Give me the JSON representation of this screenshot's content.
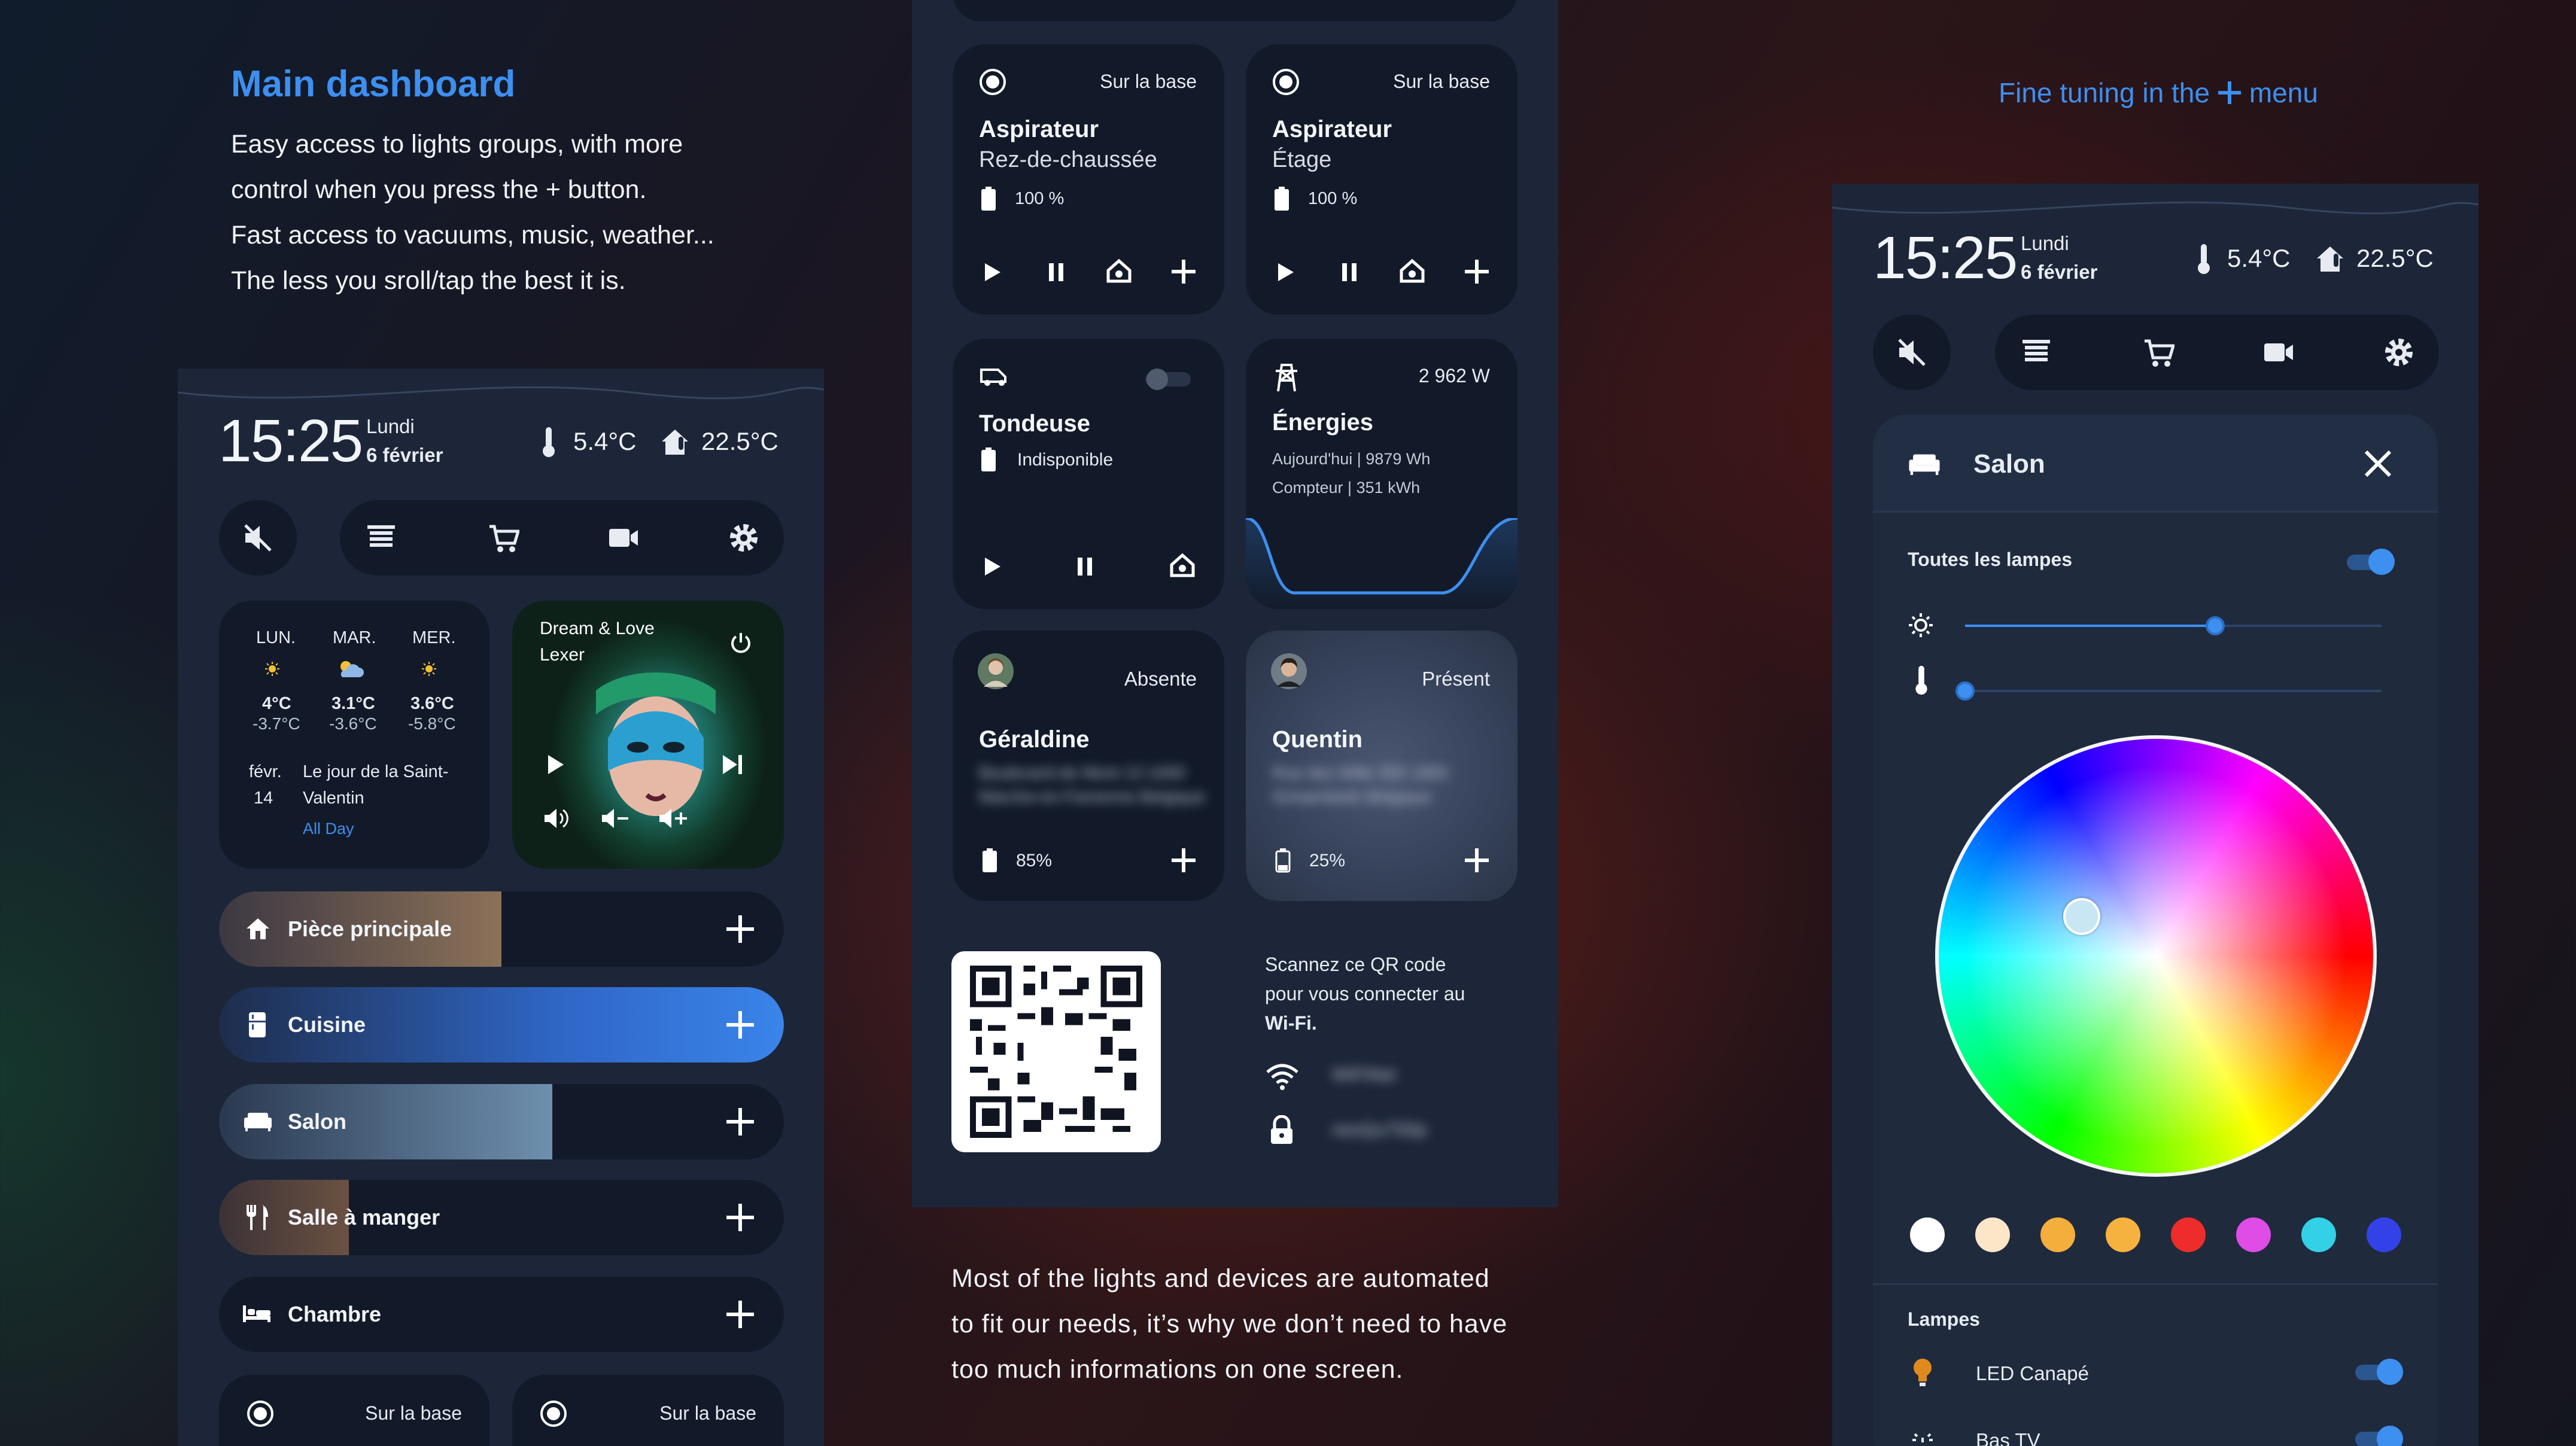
{
  "left": {
    "heading": "Main dashboard",
    "caption_lines": [
      "Easy access to lights groups, with more",
      "control when you press the + button.",
      "Fast access to vacuums, music, weather...",
      "The less you sroll/tap the best it is."
    ]
  },
  "header": {
    "time": "15:25",
    "day": "Lundi",
    "date": "6 février",
    "outdoor_temp": "5.4°C",
    "indoor_temp": "22.5°C"
  },
  "weather": {
    "days": [
      {
        "name": "LUN.",
        "high": "4°C",
        "low": "-3.7°C",
        "icon": "sun-icon"
      },
      {
        "name": "MAR.",
        "high": "3.1°C",
        "low": "-3.6°C",
        "icon": "partly-cloudy-icon"
      },
      {
        "name": "MER.",
        "high": "3.6°C",
        "low": "-5.8°C",
        "icon": "sun-icon"
      }
    ],
    "event": {
      "month": "févr.",
      "day": "14",
      "title_line1": "Le jour de la Saint-",
      "title_line2": "Valentin",
      "time": "All Day"
    }
  },
  "media": {
    "title": "Dream & Love",
    "artist": "Lexer"
  },
  "rooms": [
    {
      "label": "Pièce principale",
      "icon": "home-icon",
      "level": 0.5
    },
    {
      "label": "Cuisine",
      "icon": "fridge-icon",
      "level": 1.0
    },
    {
      "label": "Salon",
      "icon": "sofa-icon",
      "level": 0.59
    },
    {
      "label": "Salle à manger",
      "icon": "cutlery-icon",
      "level": 0.23
    },
    {
      "label": "Chambre",
      "icon": "bed-icon",
      "level": 0
    }
  ],
  "left_bottom": {
    "status1": "Sur la base",
    "status2": "Sur la base"
  },
  "middle": {
    "vac1": {
      "status": "Sur la base",
      "title": "Aspirateur",
      "subtitle": "Rez-de-chaussée",
      "battery": "100 %"
    },
    "vac2": {
      "status": "Sur la base",
      "title": "Aspirateur",
      "subtitle": "Étage",
      "battery": "100 %"
    },
    "mower": {
      "title": "Tondeuse",
      "state": "Indisponible"
    },
    "energy": {
      "power": "2 962 W",
      "title": "Énergies",
      "today": "Aujourd'hui | 9879 Wh",
      "meter": "Compteur | 351 kWh"
    },
    "person1": {
      "name": "Géraldine",
      "status": "Absente",
      "battery": "85%",
      "line1": "Boulevard de Mont 13 1000",
      "line2": "Marche-en-Famenne Belgique"
    },
    "person2": {
      "name": "Quentin",
      "status": "Présent",
      "battery": "25%",
      "line1": "Rue des Mille 355 1800",
      "line2": "Schaerbeek Belgique"
    },
    "wifi": {
      "line1": "Scannez ce QR code",
      "line2": "pour vous connecter au",
      "line3": "Wi-Fi.",
      "ssid": "WiFiNet",
      "password": "nesQu7S0p"
    },
    "caption_lines": [
      "Most of the lights and devices are automated",
      "to fit our needs, it’s why we don’t need to have",
      "too much informations on one screen."
    ]
  },
  "right": {
    "heading_pre": "Fine tuning in the",
    "heading_post": "menu",
    "room_title": "Salon",
    "all_lamps": "Toutes les lampes",
    "brightness": 0.6,
    "color_temp": 0.0,
    "lamps_heading": "Lampes",
    "lamp1": "LED Canapé",
    "lamp2": "Bas TV",
    "swatches": [
      "#ffffff",
      "#fbe6c8",
      "#f4ae3c",
      "#f6b23e",
      "#ef2c2c",
      "#e04ce6",
      "#33d1e8",
      "#3342e8"
    ]
  },
  "colors": {
    "accent": "#3d8ff0",
    "card": "#121a29",
    "panel": "#1c2638"
  }
}
